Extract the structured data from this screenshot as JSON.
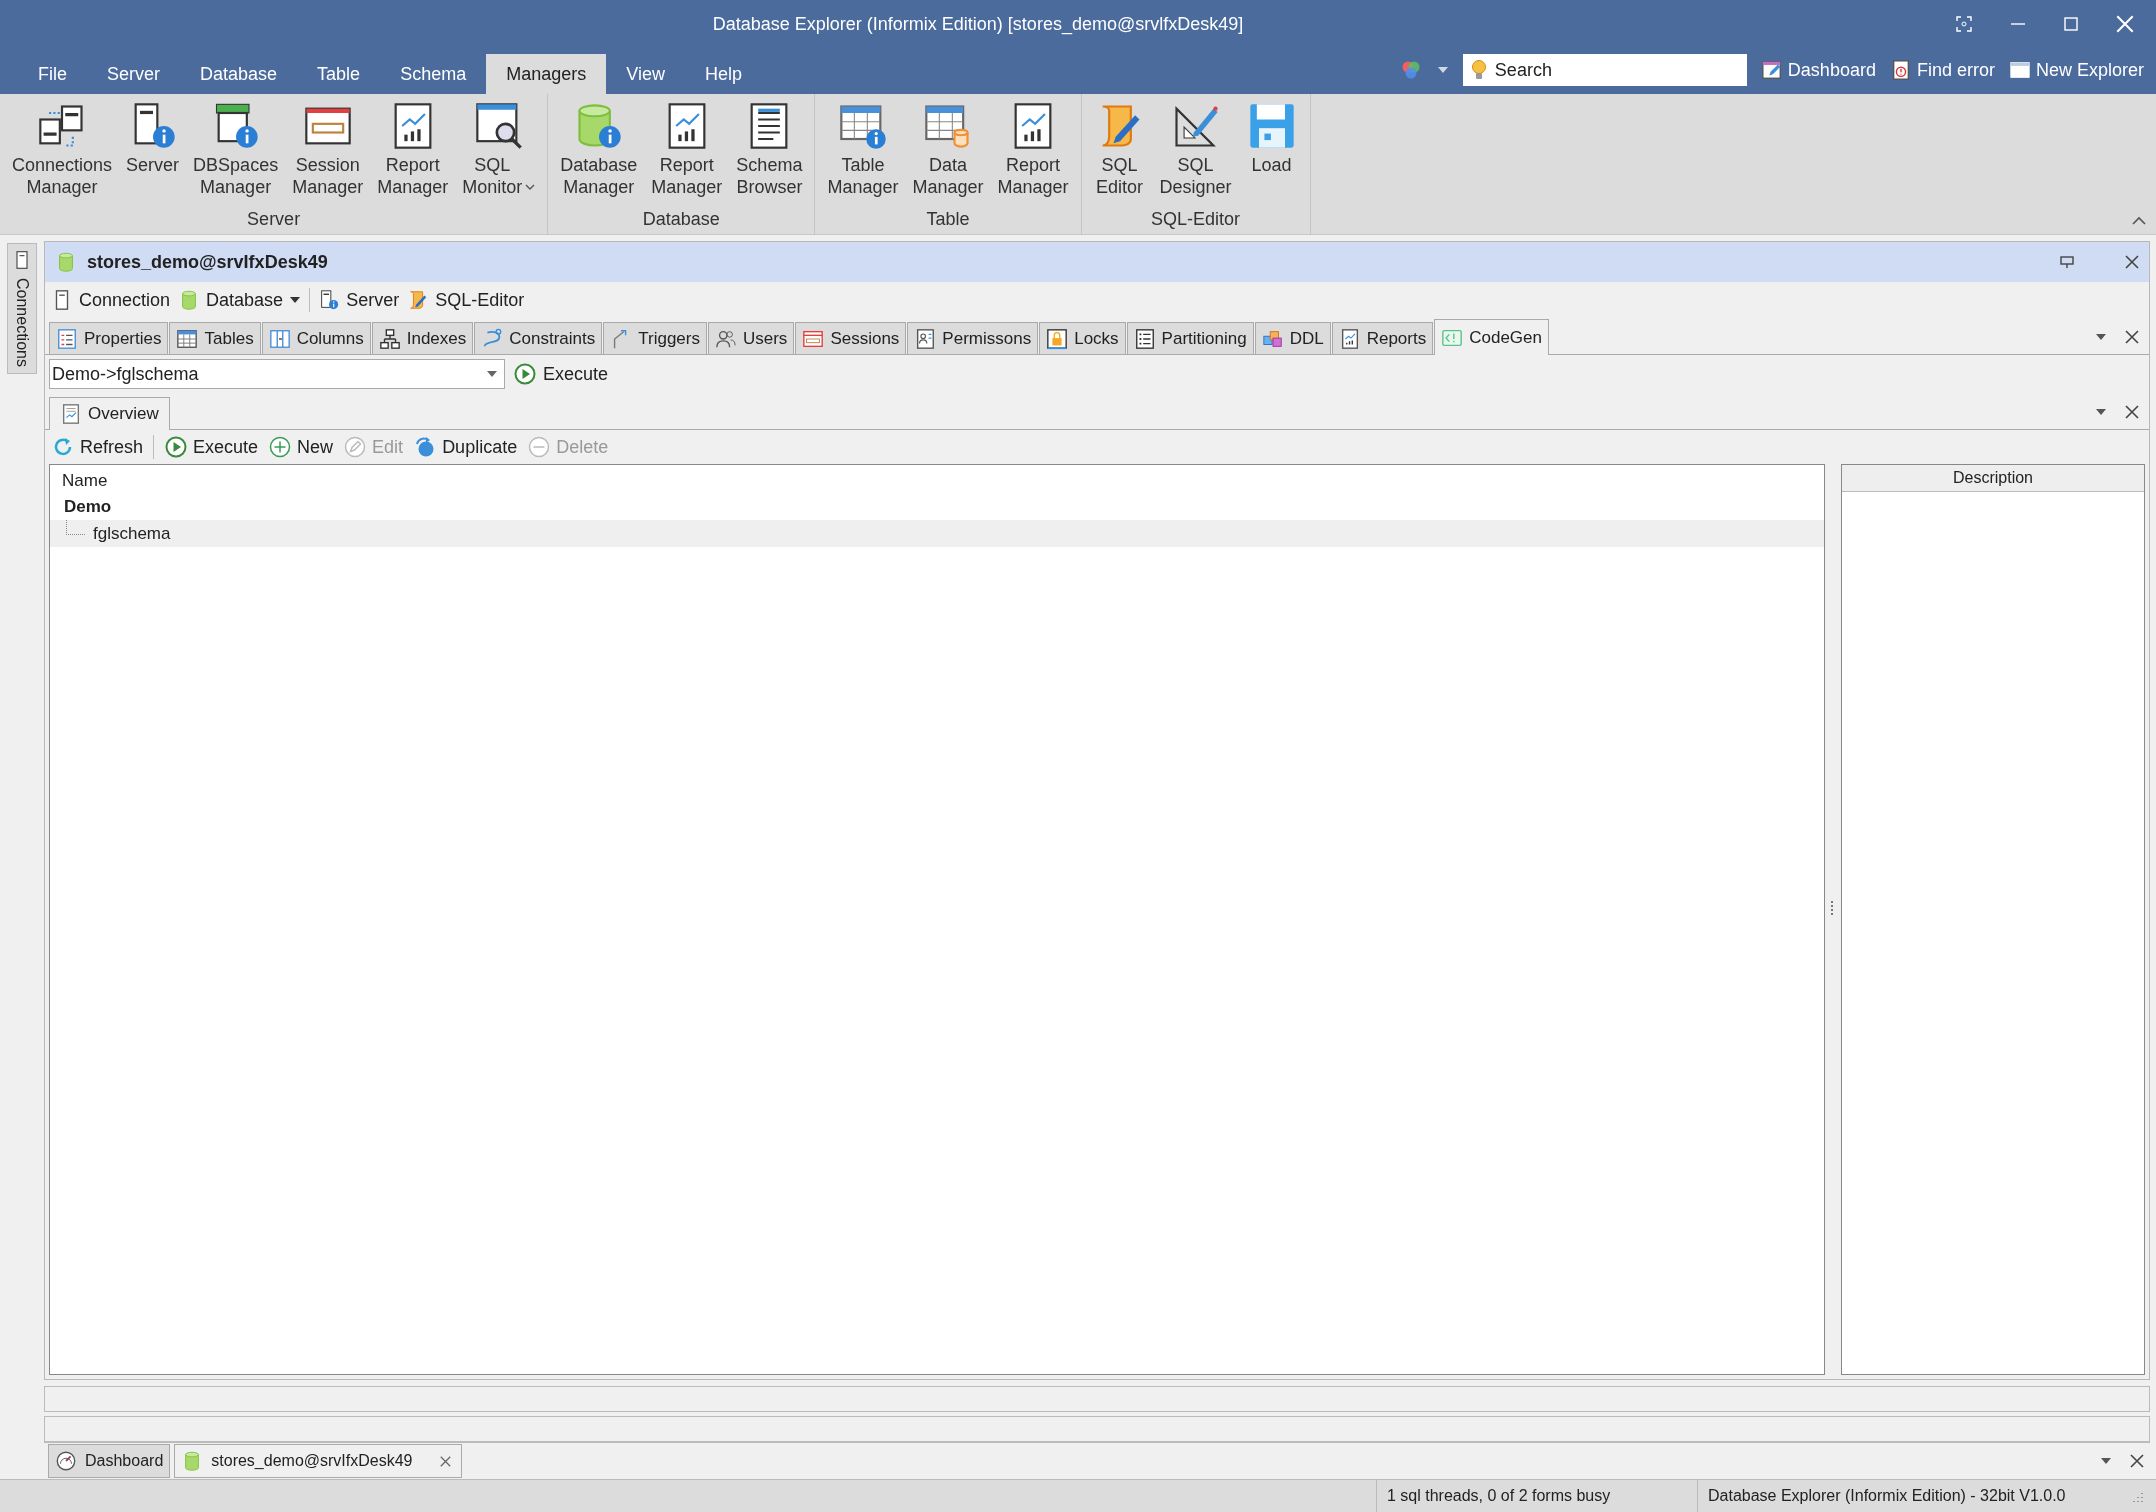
{
  "window": {
    "title": "Database Explorer (Informix Edition) [stores_demo@srvlfxDesk49]"
  },
  "menu": [
    {
      "label": "File",
      "selected": false
    },
    {
      "label": "Server",
      "selected": false
    },
    {
      "label": "Database",
      "selected": false
    },
    {
      "label": "Table",
      "selected": false
    },
    {
      "label": "Schema",
      "selected": false
    },
    {
      "label": "Managers",
      "selected": true
    },
    {
      "label": "View",
      "selected": false
    },
    {
      "label": "Help",
      "selected": false
    }
  ],
  "quick_access": {
    "search": {
      "placeholder": "Search"
    },
    "buttons": [
      "Dashboard",
      "Find error",
      "New Explorer"
    ]
  },
  "ribbon": {
    "groups": [
      {
        "label": "Server",
        "items": [
          {
            "label": "Connections Manager",
            "dropdown": false
          },
          {
            "label": "Server",
            "dropdown": false
          },
          {
            "label": "DBSpaces Manager",
            "dropdown": false
          },
          {
            "label": "Session Manager",
            "dropdown": false
          },
          {
            "label": "Report Manager",
            "dropdown": false
          },
          {
            "label": "SQL Monitor",
            "dropdown": true
          }
        ]
      },
      {
        "label": "Database",
        "items": [
          {
            "label": "Database Manager",
            "dropdown": false
          },
          {
            "label": "Report Manager",
            "dropdown": false
          },
          {
            "label": "Schema Browser",
            "dropdown": false
          }
        ]
      },
      {
        "label": "Table",
        "items": [
          {
            "label": "Table Manager",
            "dropdown": false
          },
          {
            "label": "Data Manager",
            "dropdown": false
          },
          {
            "label": "Report Manager",
            "dropdown": false
          }
        ]
      },
      {
        "label": "SQL-Editor",
        "items": [
          {
            "label": "SQL Editor",
            "dropdown": false
          },
          {
            "label": "SQL Designer",
            "dropdown": false
          },
          {
            "label": "Load",
            "dropdown": false
          }
        ]
      }
    ]
  },
  "side_panel": {
    "tab": "Connections"
  },
  "document": {
    "title": "stores_demo@srvIfxDesk49",
    "toolbar": [
      {
        "label": "Connection",
        "dropdown": false
      },
      {
        "label": "Database",
        "dropdown": true
      },
      {
        "label": "Server",
        "dropdown": false
      },
      {
        "label": "SQL-Editor",
        "dropdown": false
      }
    ],
    "tabs": [
      {
        "label": "Properties",
        "selected": false
      },
      {
        "label": "Tables",
        "selected": false
      },
      {
        "label": "Columns",
        "selected": false
      },
      {
        "label": "Indexes",
        "selected": false
      },
      {
        "label": "Constraints",
        "selected": false
      },
      {
        "label": "Triggers",
        "selected": false
      },
      {
        "label": "Users",
        "selected": false
      },
      {
        "label": "Sessions",
        "selected": false
      },
      {
        "label": "Permissons",
        "selected": false
      },
      {
        "label": "Locks",
        "selected": false
      },
      {
        "label": "Partitioning",
        "selected": false
      },
      {
        "label": "DDL",
        "selected": false
      },
      {
        "label": "Reports",
        "selected": false
      },
      {
        "label": "CodeGen",
        "selected": true
      }
    ],
    "schema_select": {
      "value": "Demo->fglschema"
    },
    "execute_button": "Execute",
    "sub_tabs": [
      {
        "label": "Overview",
        "selected": true
      }
    ],
    "actions": [
      {
        "label": "Refresh",
        "disabled": false
      },
      {
        "label": "Execute",
        "disabled": false
      },
      {
        "label": "New",
        "disabled": false
      },
      {
        "label": "Edit",
        "disabled": true
      },
      {
        "label": "Duplicate",
        "disabled": false
      },
      {
        "label": "Delete",
        "disabled": true
      }
    ],
    "tree": {
      "column": "Name",
      "nodes": [
        {
          "label": "Demo",
          "selected": false,
          "children": [
            {
              "label": "fglschema",
              "selected": true
            }
          ]
        }
      ]
    },
    "description": {
      "header": "Description"
    }
  },
  "bottom_tabs": [
    {
      "label": "Dashboard",
      "selected": false,
      "closable": false
    },
    {
      "label": "stores_demo@srvIfxDesk49",
      "selected": true,
      "closable": true
    }
  ],
  "status_bar": [
    "1 sql threads, 0 of 2 forms busy",
    "Database Explorer (Informix Edition) - 32bit V1.0.0"
  ]
}
